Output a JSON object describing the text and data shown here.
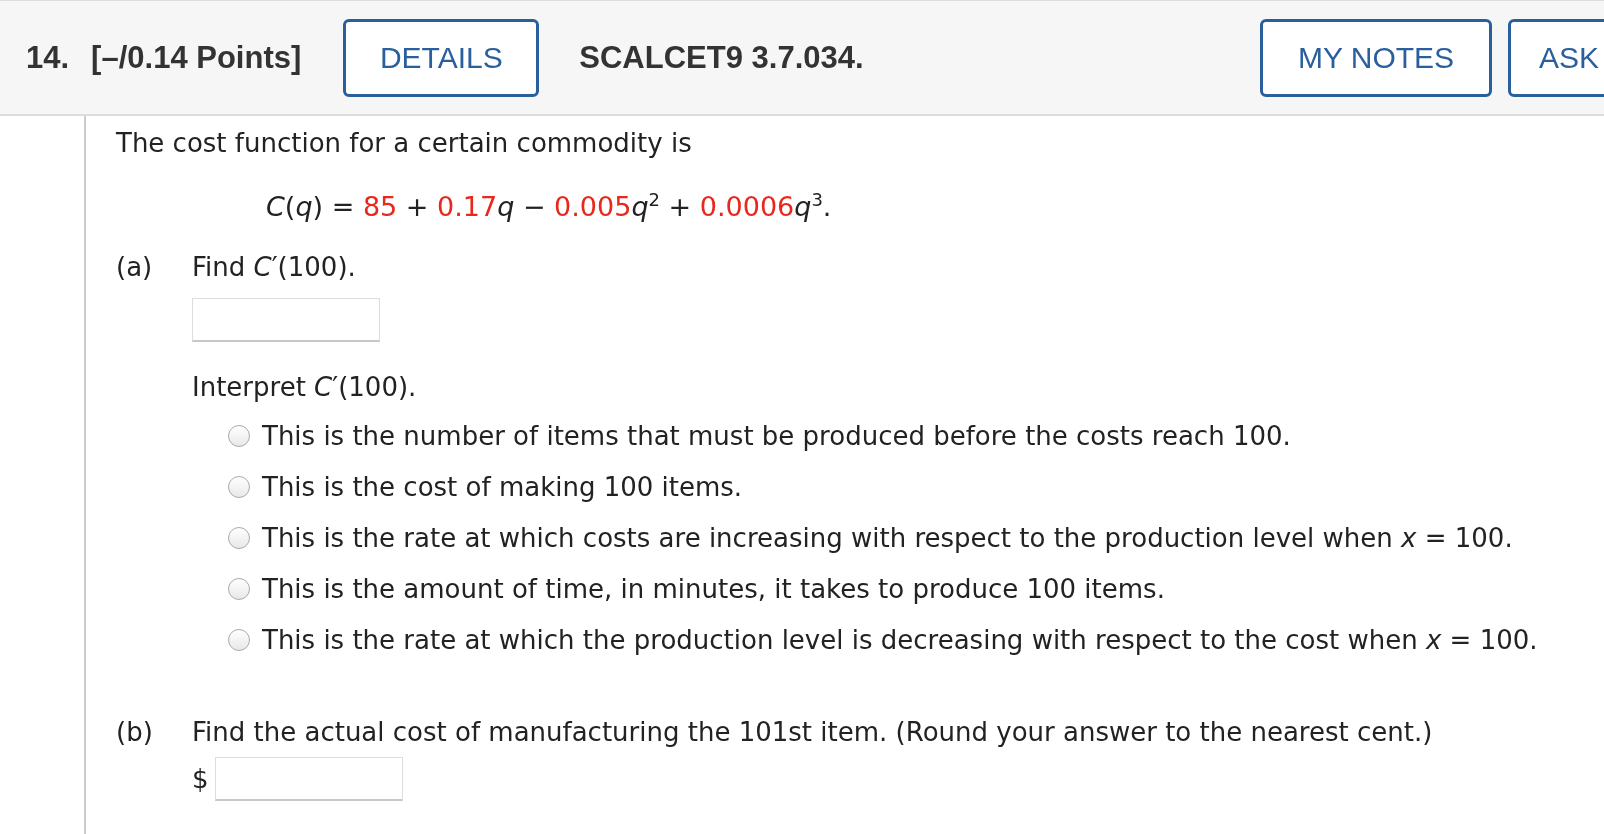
{
  "header": {
    "number": "14.",
    "points": "[–/0.14 Points]",
    "details_button": "DETAILS",
    "problem_id": "SCALCET9 3.7.034.",
    "buttons": [
      "MY NOTES",
      "ASK"
    ]
  },
  "intro": "The cost function for a certain commodity is",
  "formula": [
    {
      "kind": "plain",
      "text": "*C*(*q*) = "
    },
    {
      "kind": "coef",
      "text": "85"
    },
    {
      "kind": "plain",
      "text": " + "
    },
    {
      "kind": "coef",
      "text": "0.17"
    },
    {
      "kind": "plain",
      "text": "*q* − "
    },
    {
      "kind": "coef",
      "text": "0.005"
    },
    {
      "kind": "plain",
      "text": "*q*$^{2}$ + "
    },
    {
      "kind": "coef",
      "text": "0.0006"
    },
    {
      "kind": "plain",
      "text": "*q*$^{3}$."
    }
  ],
  "part_a": {
    "label": "(a)",
    "prompt": "Find *C*′(100).",
    "interpret": "Interpret *C*′(100).",
    "options": [
      {
        "text": "This is the number of items that must be produced before the costs reach 100.",
        "selected": false
      },
      {
        "text": "This is the cost of making 100 items.",
        "selected": false
      },
      {
        "text": "This is the rate at which costs are increasing with respect to the production level when *x* = 100.",
        "selected": false
      },
      {
        "text": "This is the amount of time, in minutes, it takes to produce 100 items.",
        "selected": false
      },
      {
        "text": "This is the rate at which the production level is decreasing with respect to the cost when *x* = 100.",
        "selected": false
      }
    ]
  },
  "part_b": {
    "label": "(b)",
    "prompt": "Find the actual cost of manufacturing the 101st item. (Round your answer to the nearest cent.)",
    "prefix": "$"
  }
}
